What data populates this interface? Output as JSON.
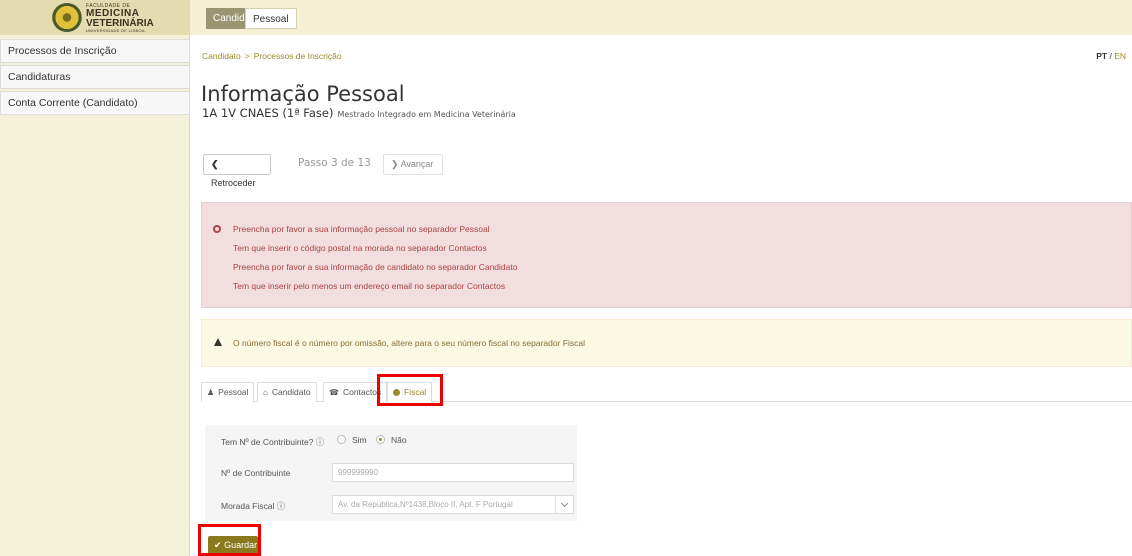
{
  "brand": {
    "line0": "FACULDADE DE",
    "line1": "MEDICINA",
    "line2": "VETERINÁRIA",
    "line3": "UNIVERSIDADE DE LISBOA"
  },
  "top_tabs": [
    {
      "label": "Candidato"
    },
    {
      "label": "Pessoal"
    }
  ],
  "sidebar": {
    "items": [
      {
        "label": "Processos de Inscrição"
      },
      {
        "label": "Candidaturas"
      },
      {
        "label": "Conta Corrente (Candidato)"
      }
    ]
  },
  "breadcrumb": {
    "items": [
      "Candidato",
      "Processos de Inscrição"
    ],
    "separator": ">"
  },
  "lang": {
    "pt": "PT",
    "sep": "/",
    "en": "EN"
  },
  "page": {
    "title": "Informação Pessoal",
    "subtitle": "1A 1V CNAES (1ª Fase)",
    "subtitle_small": "Mestrado Integrado em Medicina Veterinária"
  },
  "wizard": {
    "back_label": "Retroceder",
    "step_label": "Passo 3 de 13",
    "next_label": "Avançar"
  },
  "errors": [
    "Preencha por favor a sua informação pessoal no separador Pessoal",
    "Tem que inserir o código postal na morada no separador Contactos",
    "Preencha por favor a sua informação de candidato no separador Candidato",
    "Tem que inserir pelo menos um endereço email no separador Contactos"
  ],
  "warning": "O número fiscal é o número por omissão, altere para o seu número fiscal no separador Fiscal",
  "tabs": [
    {
      "label": "Pessoal",
      "icon": "user-icon"
    },
    {
      "label": "Candidato",
      "icon": "institution-icon"
    },
    {
      "label": "Contactos",
      "icon": "phone-icon"
    },
    {
      "label": "Fiscal",
      "icon": "info-icon"
    }
  ],
  "form": {
    "has_nif_label": "Tem Nº de Contribuinte? ⓘ",
    "opt_yes": "Sim",
    "opt_no": "Não",
    "nif_label": "Nº de Contribuinte",
    "nif_value": "999999990",
    "address_label": "Morada Fiscal ⓘ",
    "address_value": "Av. da República,Nº1438,Bloco II, Apt. F Portugal"
  },
  "save_label": "Guardar",
  "colors": {
    "accent": "#9a8a28",
    "error_bg": "#f2dede",
    "warning_bg": "#fcf8e3",
    "highlight": "#e00000"
  }
}
